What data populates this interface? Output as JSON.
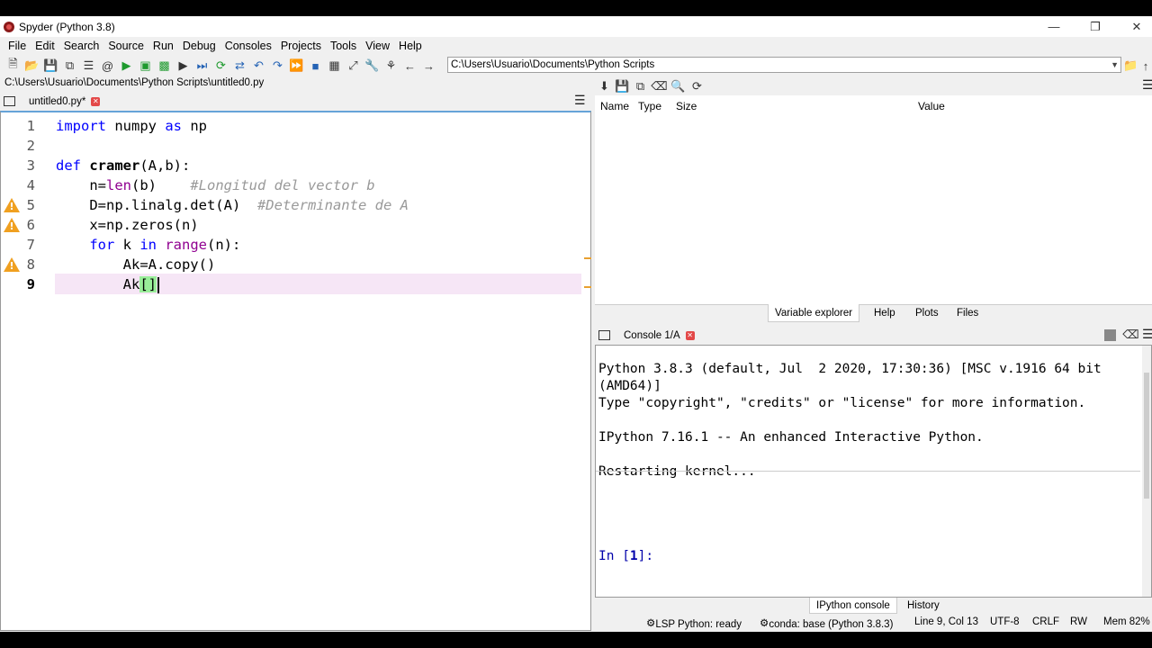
{
  "window": {
    "title": "Spyder (Python 3.8)"
  },
  "menu": [
    "File",
    "Edit",
    "Search",
    "Source",
    "Run",
    "Debug",
    "Consoles",
    "Projects",
    "Tools",
    "View",
    "Help"
  ],
  "toolbar": {
    "working_directory": "C:\\Users\\Usuario\\Documents\\Python Scripts"
  },
  "editor": {
    "file_path": "C:\\Users\\Usuario\\Documents\\Python Scripts\\untitled0.py",
    "tab_label": "untitled0.py*",
    "line_numbers": [
      "1",
      "2",
      "3",
      "4",
      "5",
      "6",
      "7",
      "8",
      "9"
    ],
    "lines": {
      "l1": {
        "kw1": "import",
        "t1": " numpy ",
        "kw2": "as",
        "t2": " np"
      },
      "l3": {
        "kw": "def",
        "sp": " ",
        "name": "cramer",
        "rest": "(A,b):"
      },
      "l4": {
        "a": "    n=",
        "bi": "len",
        "b": "(b)    ",
        "cm": "#Longitud del vector b"
      },
      "l5": {
        "a": "    D=np.linalg.det(A)  ",
        "cm": "#Determinante de A"
      },
      "l6": {
        "a": "    x=np.zeros(n)"
      },
      "l7": {
        "ind": "    ",
        "kw1": "for",
        "a": " k ",
        "kw2": "in",
        "sp": " ",
        "bi": "range",
        "b": "(n):"
      },
      "l8": {
        "a": "        Ak=A.copy()"
      },
      "l9": {
        "a": "        Ak",
        "br1": "[",
        "br2": "]"
      }
    }
  },
  "variable_explorer": {
    "columns": {
      "name": "Name",
      "type": "Type",
      "size": "Size",
      "value": "Value"
    },
    "tabs": [
      "Variable explorer",
      "Help",
      "Plots",
      "Files"
    ]
  },
  "console": {
    "tab_label": "Console 1/A",
    "lines": [
      "Python 3.8.3 (default, Jul  2 2020, 17:30:36) [MSC v.1916 64 bit",
      "(AMD64)]",
      "Type \"copyright\", \"credits\" or \"license\" for more information.",
      "IPython 7.16.1 -- An enhanced Interactive Python.",
      "Restarting kernel...",
      "In [1]:"
    ],
    "prompt_num": "1",
    "bottom_tabs": [
      "IPython console",
      "History"
    ]
  },
  "status": {
    "lsp": "LSP Python: ready",
    "conda": "conda: base (Python 3.8.3)",
    "position": "Line 9, Col 13",
    "encoding": "UTF-8",
    "eol": "CRLF",
    "rw": "RW",
    "mem": "Mem 82%"
  }
}
